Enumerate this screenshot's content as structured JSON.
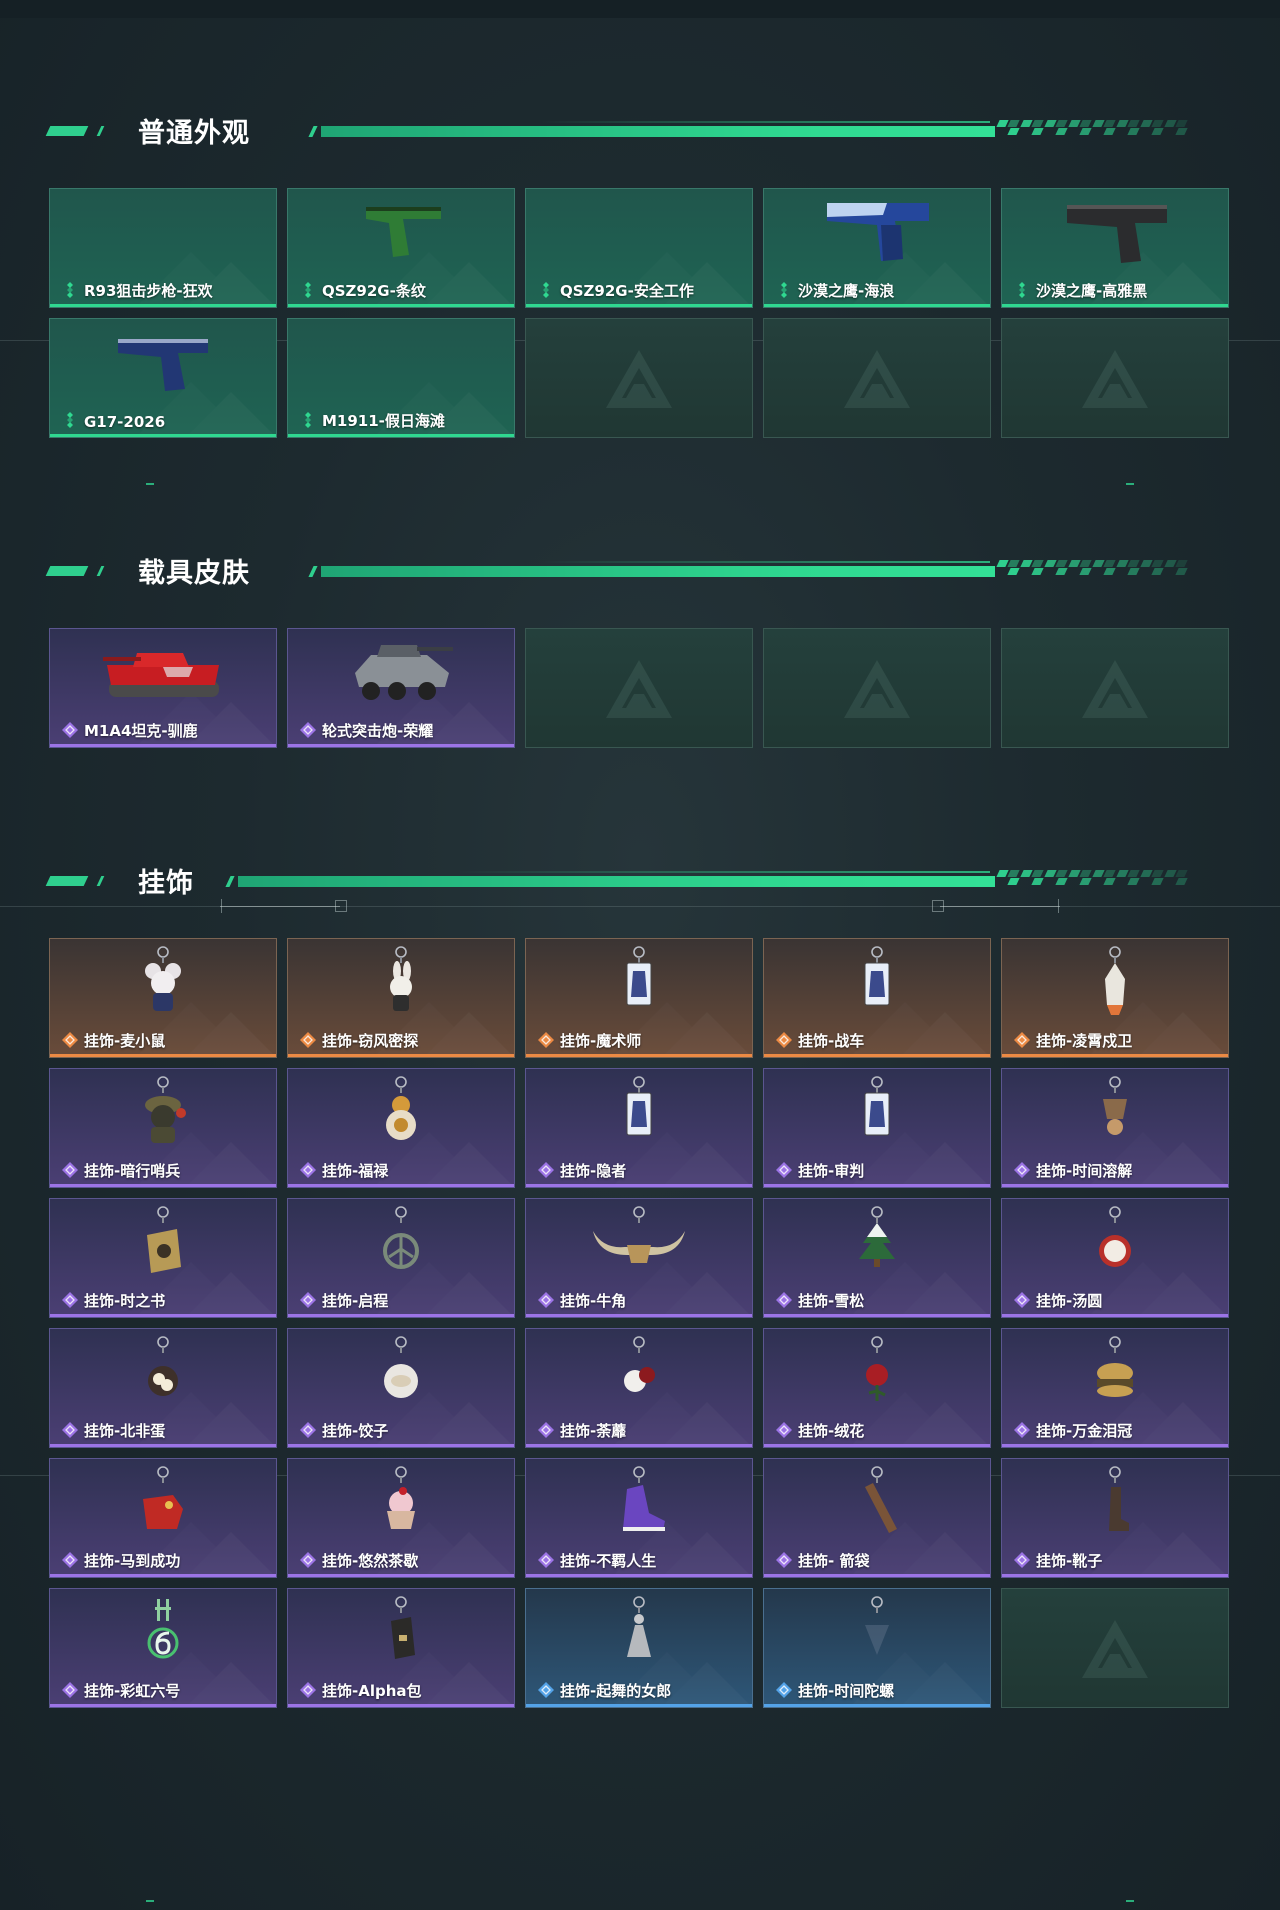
{
  "sections": [
    {
      "title": "普通外观",
      "items": [
        {
          "label": "R93狙击步枪-狂欢",
          "rarity": "green",
          "icon": "empty"
        },
        {
          "label": "QSZ92G-条纹",
          "rarity": "green",
          "icon": "pistol-green"
        },
        {
          "label": "QSZ92G-安全工作",
          "rarity": "green",
          "icon": "empty"
        },
        {
          "label": "沙漠之鹰-海浪",
          "rarity": "green",
          "icon": "pistol-blue-wave"
        },
        {
          "label": "沙漠之鹰-高雅黑",
          "rarity": "green",
          "icon": "pistol-black"
        },
        {
          "label": "G17-2026",
          "rarity": "green",
          "icon": "pistol-navy"
        },
        {
          "label": "M1911-假日海滩",
          "rarity": "green",
          "icon": "empty"
        },
        {
          "label": "",
          "rarity": "empty",
          "icon": "logo"
        },
        {
          "label": "",
          "rarity": "empty",
          "icon": "logo"
        },
        {
          "label": "",
          "rarity": "empty",
          "icon": "logo"
        }
      ]
    },
    {
      "title": "载具皮肤",
      "items": [
        {
          "label": "M1A4坦克-驯鹿",
          "rarity": "purple",
          "icon": "tank-red"
        },
        {
          "label": "轮式突击炮-荣耀",
          "rarity": "purple",
          "icon": "armored-car"
        },
        {
          "label": "",
          "rarity": "empty",
          "icon": "logo"
        },
        {
          "label": "",
          "rarity": "empty",
          "icon": "logo"
        },
        {
          "label": "",
          "rarity": "empty",
          "icon": "logo"
        }
      ]
    },
    {
      "title": "挂饰",
      "items": [
        {
          "label": "挂饰-麦小鼠",
          "rarity": "orange",
          "icon": "mouse-charm"
        },
        {
          "label": "挂饰-窃风密探",
          "rarity": "orange",
          "icon": "rabbit-charm"
        },
        {
          "label": "挂饰-魔术师",
          "rarity": "orange",
          "icon": "tarot-card"
        },
        {
          "label": "挂饰-战车",
          "rarity": "orange",
          "icon": "tarot-card"
        },
        {
          "label": "挂饰-凌霄戍卫",
          "rarity": "orange",
          "icon": "rocket-charm"
        },
        {
          "label": "挂饰-暗行哨兵",
          "rarity": "purple",
          "icon": "soldier-charm"
        },
        {
          "label": "挂饰-福禄",
          "rarity": "purple",
          "icon": "gourd-charm"
        },
        {
          "label": "挂饰-隐者",
          "rarity": "purple",
          "icon": "tarot-card"
        },
        {
          "label": "挂饰-审判",
          "rarity": "purple",
          "icon": "tarot-card"
        },
        {
          "label": "挂饰-时间溶解",
          "rarity": "purple",
          "icon": "clock-charm"
        },
        {
          "label": "挂饰-时之书",
          "rarity": "purple",
          "icon": "book-charm"
        },
        {
          "label": "挂饰-启程",
          "rarity": "purple",
          "icon": "ring-charm"
        },
        {
          "label": "挂饰-牛角",
          "rarity": "purple",
          "icon": "horns-charm"
        },
        {
          "label": "挂饰-雪松",
          "rarity": "purple",
          "icon": "tree-charm"
        },
        {
          "label": "挂饰-汤圆",
          "rarity": "purple",
          "icon": "bowl-charm"
        },
        {
          "label": "挂饰-北非蛋",
          "rarity": "purple",
          "icon": "pan-charm"
        },
        {
          "label": "挂饰-饺子",
          "rarity": "purple",
          "icon": "plate-charm"
        },
        {
          "label": "挂饰-荼蘼",
          "rarity": "purple",
          "icon": "flower-charm"
        },
        {
          "label": "挂饰-绒花",
          "rarity": "purple",
          "icon": "rose-charm"
        },
        {
          "label": "挂饰-万金泪冠",
          "rarity": "purple",
          "icon": "burger-charm"
        },
        {
          "label": "挂饰-马到成功",
          "rarity": "purple",
          "icon": "horse-charm"
        },
        {
          "label": "挂饰-悠然茶歇",
          "rarity": "purple",
          "icon": "cupcake-charm"
        },
        {
          "label": "挂饰-不羁人生",
          "rarity": "purple",
          "icon": "sneaker-charm"
        },
        {
          "label": "挂饰- 箭袋",
          "rarity": "purple",
          "icon": "quiver-charm"
        },
        {
          "label": "挂饰-靴子",
          "rarity": "purple",
          "icon": "boot-charm"
        },
        {
          "label": "挂饰-彩虹六号",
          "rarity": "purple",
          "icon": "six-charm"
        },
        {
          "label": "挂饰-Alpha包",
          "rarity": "purple",
          "icon": "bag-charm"
        },
        {
          "label": "挂饰-起舞的女郎",
          "rarity": "blue",
          "icon": "dancer-charm"
        },
        {
          "label": "挂饰-时间陀螺",
          "rarity": "blue",
          "icon": "top-charm"
        },
        {
          "label": "",
          "rarity": "empty",
          "icon": "logo"
        }
      ]
    }
  ],
  "colors": {
    "accent": "#2fcf8e",
    "green": "#2fd890",
    "purple": "#9c74e6",
    "orange": "#ec8a44",
    "blue": "#54a3e8"
  }
}
